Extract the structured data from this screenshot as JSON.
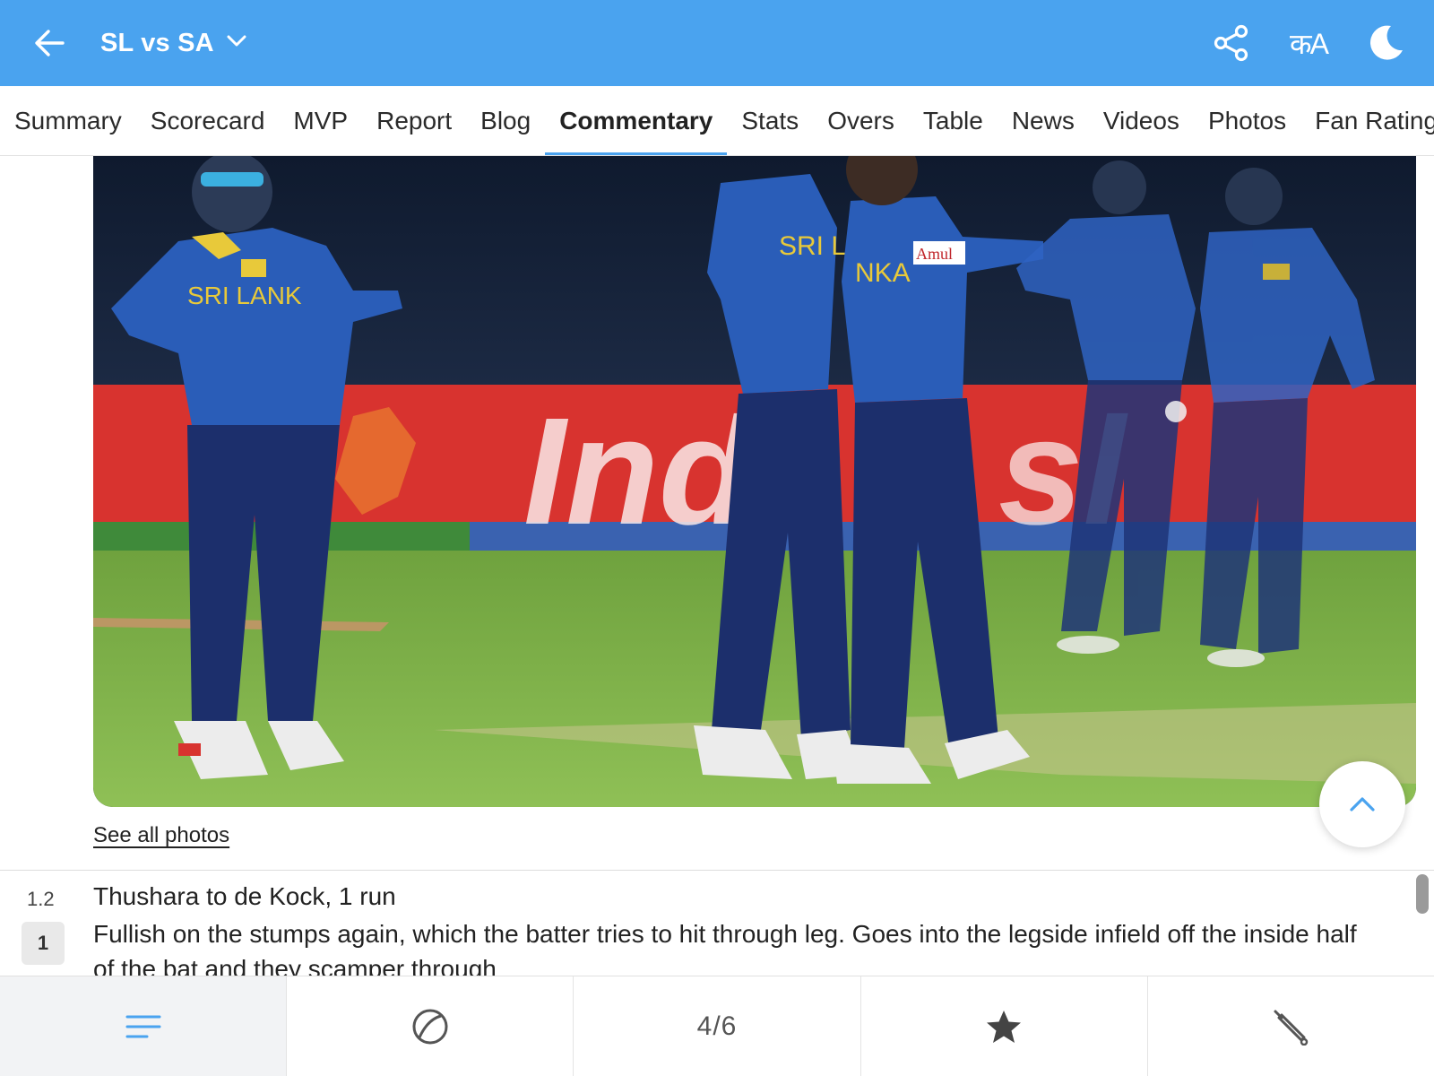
{
  "header": {
    "title": "SL vs SA",
    "back_icon": "back-arrow-icon",
    "dropdown_icon": "chevron-down-icon",
    "share_icon": "share-icon",
    "language_label": "कA",
    "theme_icon": "moon-icon",
    "background_color": "#4aa3ef"
  },
  "tabs": [
    {
      "label": "Summary",
      "active": false
    },
    {
      "label": "Scorecard",
      "active": false
    },
    {
      "label": "MVP",
      "active": false
    },
    {
      "label": "Report",
      "active": false
    },
    {
      "label": "Blog",
      "active": false
    },
    {
      "label": "Commentary",
      "active": true
    },
    {
      "label": "Stats",
      "active": false
    },
    {
      "label": "Overs",
      "active": false
    },
    {
      "label": "Table",
      "active": false
    },
    {
      "label": "News",
      "active": false
    },
    {
      "label": "Videos",
      "active": false
    },
    {
      "label": "Photos",
      "active": false
    },
    {
      "label": "Fan Ratings",
      "active": false
    }
  ],
  "photo": {
    "see_all_label": "See all photos"
  },
  "commentary": {
    "over": "1.2",
    "runs": "1",
    "headline": "Thushara to de Kock, 1 run",
    "text": "Fullish on the stumps again, which the batter tries to hit through leg. Goes into the legside infield off the inside half of the bat and they scamper through"
  },
  "bottom_nav": {
    "items": [
      {
        "icon": "menu-lines-icon",
        "active": true
      },
      {
        "icon": "cricket-ball-icon",
        "active": false
      },
      {
        "label": "4/6",
        "active": false
      },
      {
        "icon": "star-icon",
        "active": false
      },
      {
        "icon": "cricket-bat-icon",
        "active": false
      }
    ]
  },
  "colors": {
    "accent": "#4aa3ef",
    "jersey_blue": "#2a5db8",
    "jersey_yellow": "#e8c93a",
    "board_red": "#d8332f",
    "grass_green": "#7fb24a"
  }
}
